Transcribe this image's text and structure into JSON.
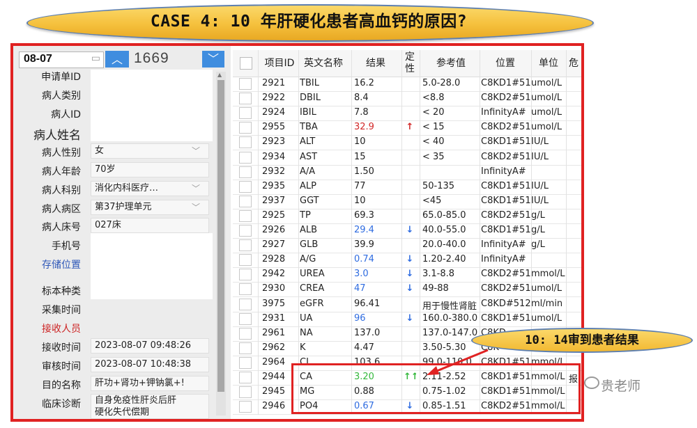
{
  "banner": {
    "title": "CASE 4:  10 年肝硬化患者高血钙的原因?"
  },
  "left_panel": {
    "date": "08-07",
    "sample_number": "1669",
    "labels": {
      "request_id": "申请单ID",
      "patient_type": "病人类别",
      "patient_id": "病人ID",
      "patient_name": "病人姓名",
      "sex": "病人性别",
      "age": "病人年龄",
      "department": "病人科别",
      "ward": "病人病区",
      "bed": "病人床号",
      "phone": "手机号",
      "storage": "存储位置",
      "specimen_type": "标本种类",
      "collect_time": "采集时间",
      "receiver": "接收人员",
      "receive_time": "接收时间",
      "review_time": "审核时间",
      "purpose": "目的名称",
      "diagnosis": "临床诊断"
    },
    "values": {
      "sex": "女",
      "age": "70岁",
      "department": "消化内科医疗…",
      "ward": "第37护理单元",
      "bed": "027床",
      "receive_time": "2023-08-07 09:48:26",
      "review_time": "2023-08-07 10:48:38",
      "purpose": "肝功+肾功+钾钠氯+!",
      "diagnosis_line1": "自身免疫性肝炎后肝",
      "diagnosis_line2": "硬化失代偿期"
    }
  },
  "table": {
    "headers": {
      "id": "项目ID",
      "en": "英文名称",
      "result": "结果",
      "flag_l1": "定",
      "flag_l2": "性",
      "ref": "参考值",
      "pos": "位置",
      "unit": "单位",
      "danger": "危"
    },
    "rows": [
      {
        "id": "2921",
        "en": "TBIL",
        "result": "16.2",
        "flag": "",
        "ref": "5.0-28.0",
        "pos": "C8KD1#51",
        "unit": "umol/L",
        "color": ""
      },
      {
        "id": "2922",
        "en": "DBIL",
        "result": "8.4",
        "flag": "",
        "ref": "<8.8",
        "pos": "C8KD2#51",
        "unit": "umol/L",
        "color": ""
      },
      {
        "id": "2924",
        "en": "IBIL",
        "result": "7.8",
        "flag": "",
        "ref": "< 20",
        "pos": "InfinityA#",
        "unit": "umol/L",
        "color": ""
      },
      {
        "id": "2955",
        "en": "TBA",
        "result": "32.9",
        "flag": "↑",
        "ref": "< 15",
        "pos": "C8KD2#51",
        "unit": "umol/L",
        "color": "red"
      },
      {
        "id": "2923",
        "en": "ALT",
        "result": "10",
        "flag": "",
        "ref": "< 40",
        "pos": "C8KD1#51",
        "unit": "IU/L",
        "color": ""
      },
      {
        "id": "2934",
        "en": "AST",
        "result": "15",
        "flag": "",
        "ref": "< 35",
        "pos": "C8KD2#51",
        "unit": "IU/L",
        "color": ""
      },
      {
        "id": "2932",
        "en": "A/A",
        "result": "1.50",
        "flag": "",
        "ref": "",
        "pos": "InfinityA#",
        "unit": "",
        "color": ""
      },
      {
        "id": "2935",
        "en": "ALP",
        "result": "77",
        "flag": "",
        "ref": "50-135",
        "pos": "C8KD1#51",
        "unit": "IU/L",
        "color": ""
      },
      {
        "id": "2937",
        "en": "GGT",
        "result": "10",
        "flag": "",
        "ref": "<45",
        "pos": "C8KD1#51",
        "unit": "IU/L",
        "color": ""
      },
      {
        "id": "2925",
        "en": "TP",
        "result": "69.3",
        "flag": "",
        "ref": "65.0-85.0",
        "pos": "C8KD2#51",
        "unit": "g/L",
        "color": ""
      },
      {
        "id": "2926",
        "en": "ALB",
        "result": "29.4",
        "flag": "↓",
        "ref": "40.0-55.0",
        "pos": "C8KD1#51",
        "unit": "g/L",
        "color": "blue"
      },
      {
        "id": "2927",
        "en": "GLB",
        "result": "39.9",
        "flag": "",
        "ref": "20.0-40.0",
        "pos": "InfinityA#",
        "unit": "g/L",
        "color": ""
      },
      {
        "id": "2928",
        "en": "A/G",
        "result": "0.74",
        "flag": "↓",
        "ref": "1.20-2.40",
        "pos": "InfinityA#",
        "unit": "",
        "color": "blue"
      },
      {
        "id": "2942",
        "en": "UREA",
        "result": "3.0",
        "flag": "↓",
        "ref": "3.1-8.8",
        "pos": "C8KD2#51",
        "unit": "mmol/L",
        "color": "blue"
      },
      {
        "id": "2930",
        "en": "CREA",
        "result": "47",
        "flag": "↓",
        "ref": "49-88",
        "pos": "C8KD2#51",
        "unit": "umol/L",
        "color": "blue"
      },
      {
        "id": "3975",
        "en": "eGFR",
        "result": "96.41",
        "flag": "",
        "ref": "用于慢性肾脏",
        "pos": "C8KD#512",
        "unit": "ml/min",
        "color": ""
      },
      {
        "id": "2931",
        "en": "UA",
        "result": "96",
        "flag": "↓",
        "ref": "160.0-380.0",
        "pos": "C8KD1#51",
        "unit": "umol/L",
        "color": "blue"
      },
      {
        "id": "2961",
        "en": "NA",
        "result": "137.0",
        "flag": "",
        "ref": "137.0-147.0",
        "pos": "C8KD",
        "unit": "",
        "color": ""
      },
      {
        "id": "2962",
        "en": "K",
        "result": "4.47",
        "flag": "",
        "ref": "3.50-5.30",
        "pos": "C8K",
        "unit": "",
        "color": ""
      },
      {
        "id": "2964",
        "en": "CL",
        "result": "103.6",
        "flag": "",
        "ref": "99.0-110.0",
        "pos": "C8KD1#51",
        "unit": "mmol/L",
        "color": ""
      },
      {
        "id": "2944",
        "en": "CA",
        "result": "3.20",
        "flag": "↑↑",
        "ref": "2.11-2.52",
        "pos": "C8KD1#51",
        "unit": "mmol/L",
        "extra": "报",
        "color": "green"
      },
      {
        "id": "2945",
        "en": "MG",
        "result": "0.88",
        "flag": "",
        "ref": "0.75-1.02",
        "pos": "C8KD1#51",
        "unit": "mmol/L",
        "color": ""
      },
      {
        "id": "2946",
        "en": "PO4",
        "result": "0.67",
        "flag": "↓",
        "ref": "0.85-1.51",
        "pos": "C8KD2#51",
        "unit": "mmol/L",
        "color": "blue"
      }
    ]
  },
  "callout": {
    "text": "10: 14审到患者结果"
  },
  "watermark": {
    "text": "贵老师"
  }
}
